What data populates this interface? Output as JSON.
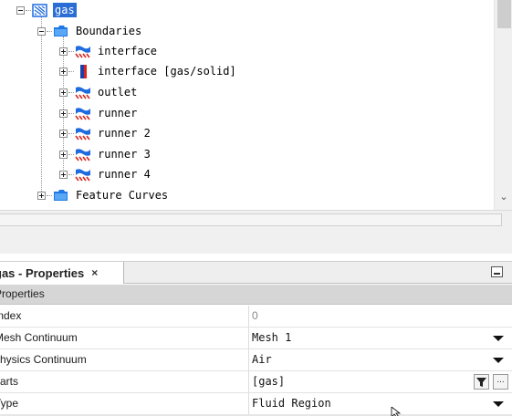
{
  "tree": {
    "root_label": "gas",
    "boundaries_label": "Boundaries",
    "boundaries": [
      {
        "label": "interface",
        "icon": "boundary-icon"
      },
      {
        "label": "interface [gas/solid]",
        "icon": "interface-icon"
      },
      {
        "label": "outlet",
        "icon": "boundary-icon"
      },
      {
        "label": "runner",
        "icon": "boundary-icon"
      },
      {
        "label": "runner 2",
        "icon": "boundary-icon"
      },
      {
        "label": "runner 3",
        "icon": "boundary-icon"
      },
      {
        "label": "runner 4",
        "icon": "boundary-icon"
      }
    ],
    "feature_curves_label": "Feature Curves"
  },
  "properties": {
    "tab_title": "gas - Properties",
    "close_glyph": "×",
    "ellipsis": "...",
    "section_label": "Properties",
    "rows": [
      {
        "name": "Index",
        "value": "0"
      },
      {
        "name": "Mesh Continuum",
        "value": "Mesh 1"
      },
      {
        "name": "Physics Continuum",
        "value": "Air"
      },
      {
        "name": "Parts",
        "value": "[gas]"
      },
      {
        "name": "Type",
        "value": "Fluid Region"
      }
    ]
  },
  "colors": {
    "selection": "#2a6dd4",
    "folder": "#1e78e6",
    "boundary_blue": "#1e6be0",
    "boundary_red": "#d8241d"
  }
}
